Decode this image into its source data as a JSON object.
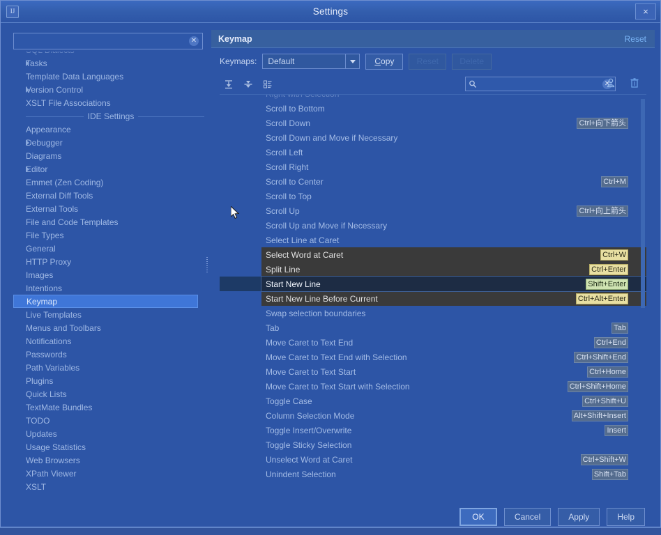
{
  "window": {
    "title": "Settings",
    "app_icon": "idea-icon",
    "close_label": "×"
  },
  "sidebar": {
    "search": {
      "value": "",
      "placeholder": "",
      "clear_icon": "clear-icon"
    },
    "items": [
      {
        "label": "SQL Dialects",
        "twisty": false,
        "partial": true,
        "indent": 0
      },
      {
        "label": "Tasks",
        "twisty": true,
        "indent": 0
      },
      {
        "label": "Template Data Languages",
        "twisty": false,
        "indent": 0
      },
      {
        "label": "Version Control",
        "twisty": true,
        "indent": 0
      },
      {
        "label": "XSLT File Associations",
        "twisty": false,
        "indent": 0
      },
      {
        "label": "IDE Settings",
        "separator": true
      },
      {
        "label": "Appearance",
        "twisty": false,
        "indent": 0
      },
      {
        "label": "Debugger",
        "twisty": true,
        "indent": 0
      },
      {
        "label": "Diagrams",
        "twisty": false,
        "indent": 0
      },
      {
        "label": "Editor",
        "twisty": true,
        "indent": 0
      },
      {
        "label": "Emmet (Zen Coding)",
        "twisty": false,
        "indent": 0
      },
      {
        "label": "External Diff Tools",
        "twisty": false,
        "indent": 0
      },
      {
        "label": "External Tools",
        "twisty": false,
        "indent": 0
      },
      {
        "label": "File and Code Templates",
        "twisty": false,
        "indent": 0
      },
      {
        "label": "File Types",
        "twisty": false,
        "indent": 0
      },
      {
        "label": "General",
        "twisty": false,
        "indent": 0
      },
      {
        "label": "HTTP Proxy",
        "twisty": false,
        "indent": 0
      },
      {
        "label": "Images",
        "twisty": false,
        "indent": 0
      },
      {
        "label": "Intentions",
        "twisty": false,
        "indent": 0
      },
      {
        "label": "Keymap",
        "twisty": false,
        "indent": 0,
        "selected": true
      },
      {
        "label": "Live Templates",
        "twisty": false,
        "indent": 0
      },
      {
        "label": "Menus and Toolbars",
        "twisty": false,
        "indent": 0
      },
      {
        "label": "Notifications",
        "twisty": false,
        "indent": 0
      },
      {
        "label": "Passwords",
        "twisty": false,
        "indent": 0
      },
      {
        "label": "Path Variables",
        "twisty": false,
        "indent": 0
      },
      {
        "label": "Plugins",
        "twisty": false,
        "indent": 0
      },
      {
        "label": "Quick Lists",
        "twisty": false,
        "indent": 0
      },
      {
        "label": "TextMate Bundles",
        "twisty": false,
        "indent": 0
      },
      {
        "label": "TODO",
        "twisty": false,
        "indent": 0
      },
      {
        "label": "Updates",
        "twisty": false,
        "indent": 0
      },
      {
        "label": "Usage Statistics",
        "twisty": false,
        "indent": 0
      },
      {
        "label": "Web Browsers",
        "twisty": false,
        "indent": 0
      },
      {
        "label": "XPath Viewer",
        "twisty": false,
        "indent": 0
      },
      {
        "label": "XSLT",
        "twisty": false,
        "indent": 0
      }
    ]
  },
  "page": {
    "title": "Keymap",
    "reset_label": "Reset",
    "keymaps_label": "Keymaps:",
    "keymap_selected": "Default",
    "keymap_options": [
      "Default"
    ],
    "copy_label": "Copy",
    "reset_button_label": "Reset",
    "delete_button_label": "Delete"
  },
  "toolbar": {
    "icons": [
      "expand-all-icon",
      "collapse-all-icon",
      "edit-shortcut-icon"
    ],
    "filter": {
      "value": "",
      "placeholder": "",
      "search_icon": "search-icon",
      "clear_icon": "clear-icon"
    },
    "right_icons": [
      "find-actions-by-shortcut-icon",
      "reset-shortcuts-icon"
    ]
  },
  "actions": [
    {
      "name": "Right with Selection",
      "shortcut": "",
      "partial": true
    },
    {
      "name": "Scroll to Bottom",
      "shortcut": ""
    },
    {
      "name": "Scroll Down",
      "shortcut": "Ctrl+向下箭头"
    },
    {
      "name": "Scroll Down and Move if Necessary",
      "shortcut": ""
    },
    {
      "name": "Scroll Left",
      "shortcut": ""
    },
    {
      "name": "Scroll Right",
      "shortcut": ""
    },
    {
      "name": "Scroll to Center",
      "shortcut": "Ctrl+M"
    },
    {
      "name": "Scroll to Top",
      "shortcut": ""
    },
    {
      "name": "Scroll Up",
      "shortcut": "Ctrl+向上箭头"
    },
    {
      "name": "Scroll Up and Move if Necessary",
      "shortcut": ""
    },
    {
      "name": "Select Line at Caret",
      "shortcut": ""
    }
  ],
  "overlay_actions": [
    {
      "name": "Select Word at Caret",
      "shortcut": "Ctrl+W",
      "selected": false
    },
    {
      "name": "Split Line",
      "shortcut": "Ctrl+Enter",
      "selected": false
    },
    {
      "name": "Start New Line",
      "shortcut": "Shift+Enter",
      "selected": true
    },
    {
      "name": "Start New Line Before Current",
      "shortcut": "Ctrl+Alt+Enter",
      "selected": false
    }
  ],
  "actions_after": [
    {
      "name": "Swap selection boundaries",
      "shortcut": ""
    },
    {
      "name": "Tab",
      "shortcut": "Tab"
    },
    {
      "name": "Move Caret to Text End",
      "shortcut": "Ctrl+End"
    },
    {
      "name": "Move Caret to Text End with Selection",
      "shortcut": "Ctrl+Shift+End"
    },
    {
      "name": "Move Caret to Text Start",
      "shortcut": "Ctrl+Home"
    },
    {
      "name": "Move Caret to Text Start with Selection",
      "shortcut": "Ctrl+Shift+Home"
    },
    {
      "name": "Toggle Case",
      "shortcut": "Ctrl+Shift+U"
    },
    {
      "name": "Column Selection Mode",
      "shortcut": "Alt+Shift+Insert"
    },
    {
      "name": "Toggle Insert/Overwrite",
      "shortcut": "Insert"
    },
    {
      "name": "Toggle Sticky Selection",
      "shortcut": ""
    },
    {
      "name": "Unselect Word at Caret",
      "shortcut": "Ctrl+Shift+W"
    },
    {
      "name": "Unindent Selection",
      "shortcut": "Shift+Tab"
    }
  ],
  "footer": {
    "ok_label": "OK",
    "cancel_label": "Cancel",
    "apply_label": "Apply",
    "help_label": "Help"
  },
  "colors": {
    "window_bg": "#2d55a6",
    "title_bg": "#335ead",
    "selection_blue": "#3f76d8",
    "overlay_dark": "#3a3a3a",
    "shortcut_chip": "#546c8e",
    "shortcut_chip_highlight": "#e8dfa2",
    "accent_link": "#7ab4f5"
  }
}
